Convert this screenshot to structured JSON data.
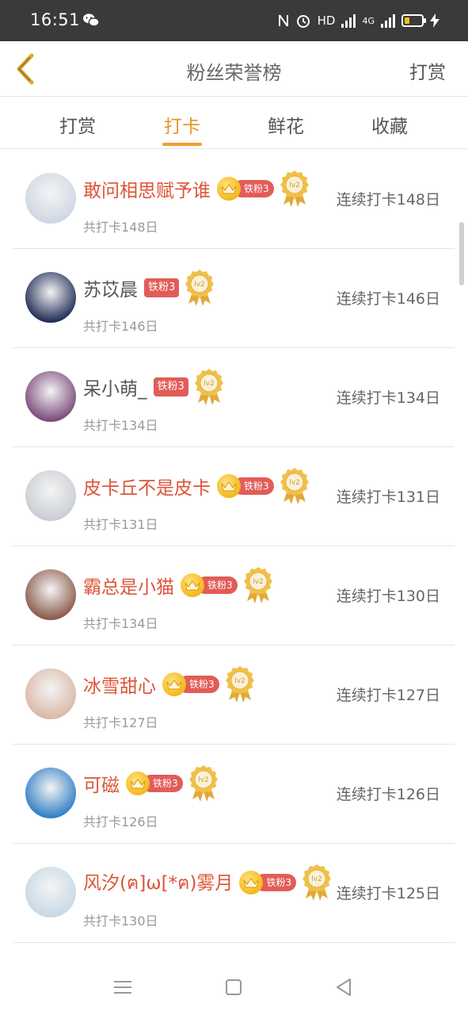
{
  "status_bar": {
    "time": "16:51",
    "network": "HD",
    "signal1": "4G",
    "signal2": "4G",
    "battery_color": "#f3c21b"
  },
  "header": {
    "back_icon": "chevron-left-icon",
    "title": "粉丝荣誉榜",
    "action": "打赏",
    "accent": "#e8962a"
  },
  "tabs": [
    {
      "label": "打赏",
      "active": false
    },
    {
      "label": "打卡",
      "active": true
    },
    {
      "label": "鲜花",
      "active": false
    },
    {
      "label": "收藏",
      "active": false
    }
  ],
  "rows": [
    {
      "name": "敢问相思赋予谁",
      "vip": true,
      "badge": "铁粉3",
      "medal": "lv2",
      "total": "共打卡148日",
      "streak": "连续打卡148日",
      "avatar_color": "#cfd6e3"
    },
    {
      "name": "苏苡晨",
      "vip": false,
      "badge": "铁粉3",
      "medal": "lv2",
      "total": "共打卡146日",
      "streak": "连续打卡146日",
      "avatar_color": "#1f2c55"
    },
    {
      "name": "呆小萌_",
      "vip": false,
      "badge": "铁粉3",
      "medal": "lv2",
      "total": "共打卡134日",
      "streak": "连续打卡134日",
      "avatar_color": "#7a4a7a"
    },
    {
      "name": "皮卡丘不是皮卡",
      "vip": true,
      "badge": "铁粉3",
      "medal": "lv2",
      "total": "共打卡131日",
      "streak": "连续打卡131日",
      "avatar_color": "#c9cdd3"
    },
    {
      "name": "霸总是小猫",
      "vip": true,
      "badge": "铁粉3",
      "medal": "lv2",
      "total": "共打卡134日",
      "streak": "连续打卡130日",
      "avatar_color": "#8a5a4a"
    },
    {
      "name": "冰雪甜心",
      "vip": true,
      "badge": "铁粉3",
      "medal": "lv2",
      "total": "共打卡127日",
      "streak": "连续打卡127日",
      "avatar_color": "#d9b8a6"
    },
    {
      "name": "可磁",
      "vip": true,
      "badge": "铁粉3",
      "medal": "lv2",
      "total": "共打卡126日",
      "streak": "连续打卡126日",
      "avatar_color": "#2f7fc4"
    },
    {
      "name": "风汐(ฅ]ω[*ฅ)雾月",
      "vip": true,
      "badge": "铁粉3",
      "medal": "lv2",
      "total": "共打卡130日",
      "streak": "连续打卡125日",
      "avatar_color": "#c8d8e4"
    }
  ],
  "nav": {
    "menu_icon": "menu-icon",
    "home_icon": "home-square-icon",
    "back_icon": "back-triangle-icon"
  }
}
